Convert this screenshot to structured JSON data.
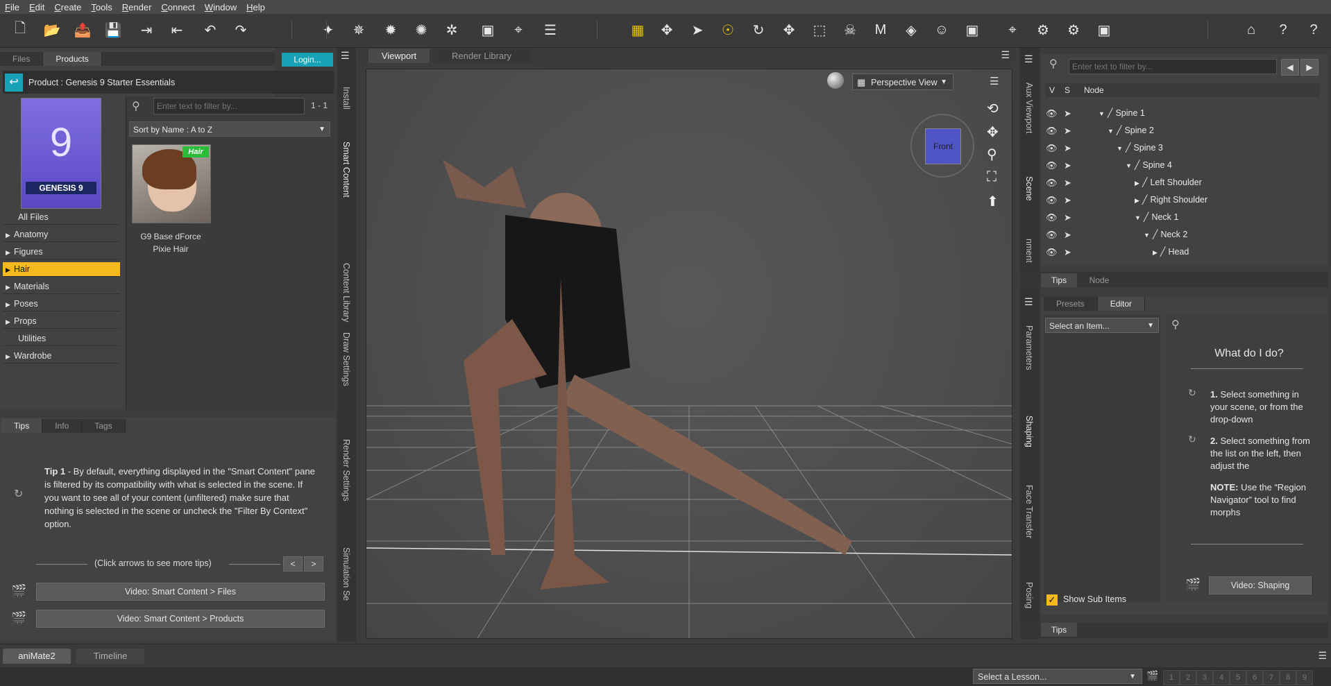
{
  "menu": [
    "File",
    "Edit",
    "Create",
    "Tools",
    "Render",
    "Connect",
    "Window",
    "Help"
  ],
  "toolbar_icons": [
    "new-file-icon",
    "open-file-icon",
    "merge-icon",
    "save-icon",
    "import-icon",
    "export-icon",
    "undo-icon",
    "redo-icon",
    "create-new-figure-icon",
    "spotlight-icon",
    "point-light-icon",
    "distant-light-icon",
    "linear-point-light-icon",
    "create-primitive-icon",
    "create-node-icon",
    "align-icon",
    "render-settings-icon",
    "universal-tool-icon",
    "node-selection-icon",
    "active-pose-tool-icon",
    "rotate-tool-icon",
    "translate-tool-icon",
    "scale-tool-icon",
    "joint-editor-icon",
    "morph-tool-icon",
    "geometry-editor-icon",
    "figure-setup-icon",
    "camera-tool-icon",
    "surface-selection-icon",
    "render-settings-gear-icon",
    "render-icon",
    "render-camera-icon",
    "daz-central-icon",
    "whats-this-icon",
    "help-icon"
  ],
  "left": {
    "tabs": [
      "Files",
      "Products"
    ],
    "active_tab": "Products",
    "login": "Login...",
    "product_label": "Product :  Genesis 9 Starter Essentials",
    "thumb_caption": "GENESIS 9",
    "thumb_number": "9",
    "filter_placeholder": "Enter text to filter by...",
    "count": "1 - 1",
    "sort": "Sort by Name : A to Z",
    "categories": [
      {
        "label": "All Files",
        "arrow": false
      },
      {
        "label": "Anatomy",
        "arrow": true
      },
      {
        "label": "Figures",
        "arrow": true
      },
      {
        "label": "Hair",
        "arrow": true,
        "selected": true
      },
      {
        "label": "Materials",
        "arrow": true
      },
      {
        "label": "Poses",
        "arrow": true
      },
      {
        "label": "Props",
        "arrow": true
      },
      {
        "label": "Utilities",
        "arrow": false
      },
      {
        "label": "Wardrobe",
        "arrow": true
      }
    ],
    "item": {
      "badge": "Hair",
      "name_line1": "G9 Base dForce",
      "name_line2": "Pixie Hair"
    },
    "vtabs": [
      "Install",
      "Smart Content",
      "Content Library",
      "Draw Settings",
      "Render Settings",
      "Simulation Se"
    ]
  },
  "tips": {
    "tabs": [
      "Tips",
      "Info",
      "Tags"
    ],
    "active_tab": "Tips",
    "tip_title": "Tip 1",
    "tip_text": " - By default, everything displayed in the \"Smart Content\" pane is filtered by its compatibility with what is selected in the scene. If you want to see all of your content (unfiltered) make sure that nothing is selected in the scene or uncheck the \"Filter By Context\" option.",
    "nav_text": "(Click arrows to see more tips)",
    "prev": "<",
    "next": ">",
    "video1": "Video: Smart Content > Files",
    "video2": "Video: Smart Content > Products"
  },
  "viewport": {
    "tabs": [
      "Viewport",
      "Render Library"
    ],
    "active_tab": "Viewport",
    "view": "Perspective View",
    "cube_label": "Front"
  },
  "scene": {
    "vtabs": [
      "Aux Viewport",
      "Scene",
      "nment"
    ],
    "filter_placeholder": "Enter text to filter by...",
    "col_v": "V",
    "col_s": "S",
    "col_node": "Node",
    "nodes": [
      {
        "label": "Spine 1",
        "indent": 0,
        "expanded": true
      },
      {
        "label": "Spine 2",
        "indent": 1,
        "expanded": true
      },
      {
        "label": "Spine 3",
        "indent": 2,
        "expanded": true
      },
      {
        "label": "Spine 4",
        "indent": 3,
        "expanded": true
      },
      {
        "label": "Left Shoulder",
        "indent": 4,
        "expanded": false
      },
      {
        "label": "Right Shoulder",
        "indent": 4,
        "expanded": false
      },
      {
        "label": "Neck 1",
        "indent": 4,
        "expanded": true
      },
      {
        "label": "Neck 2",
        "indent": 5,
        "expanded": true
      },
      {
        "label": "Head",
        "indent": 6,
        "expanded": false
      }
    ],
    "bottom_tabs": [
      "Tips",
      "Node"
    ]
  },
  "shaping": {
    "tabs": [
      "Presets",
      "Editor"
    ],
    "active_tab": "Editor",
    "vtabs": [
      "Parameters",
      "Shaping",
      "Face Transfer",
      "Posing"
    ],
    "select": "Select an Item...",
    "show_sub_items": "Show Sub Items",
    "help_title": "What do I do?",
    "step1_num": "1.",
    "step1": " Select something in your scene, or from the drop-down",
    "step2_num": "2.",
    "step2": " Select something from the list on the left, then adjust the",
    "note_label": "NOTE:",
    "note": " Use the “Region Navigator” tool to find morphs",
    "video": "Video: Shaping",
    "bottom_tab": "Tips"
  },
  "bottom": {
    "tabs": [
      "aniMate2",
      "Timeline"
    ],
    "active_tab": "aniMate2",
    "lesson": "Select a Lesson...",
    "pages": [
      "1",
      "2",
      "3",
      "4",
      "5",
      "6",
      "7",
      "8",
      "9"
    ]
  },
  "colors": {
    "accent_yellow": "#f5b91b",
    "login_cyan": "#18a2b8",
    "hair_badge": "#2bbd3a",
    "cube": "#4f55c7"
  }
}
